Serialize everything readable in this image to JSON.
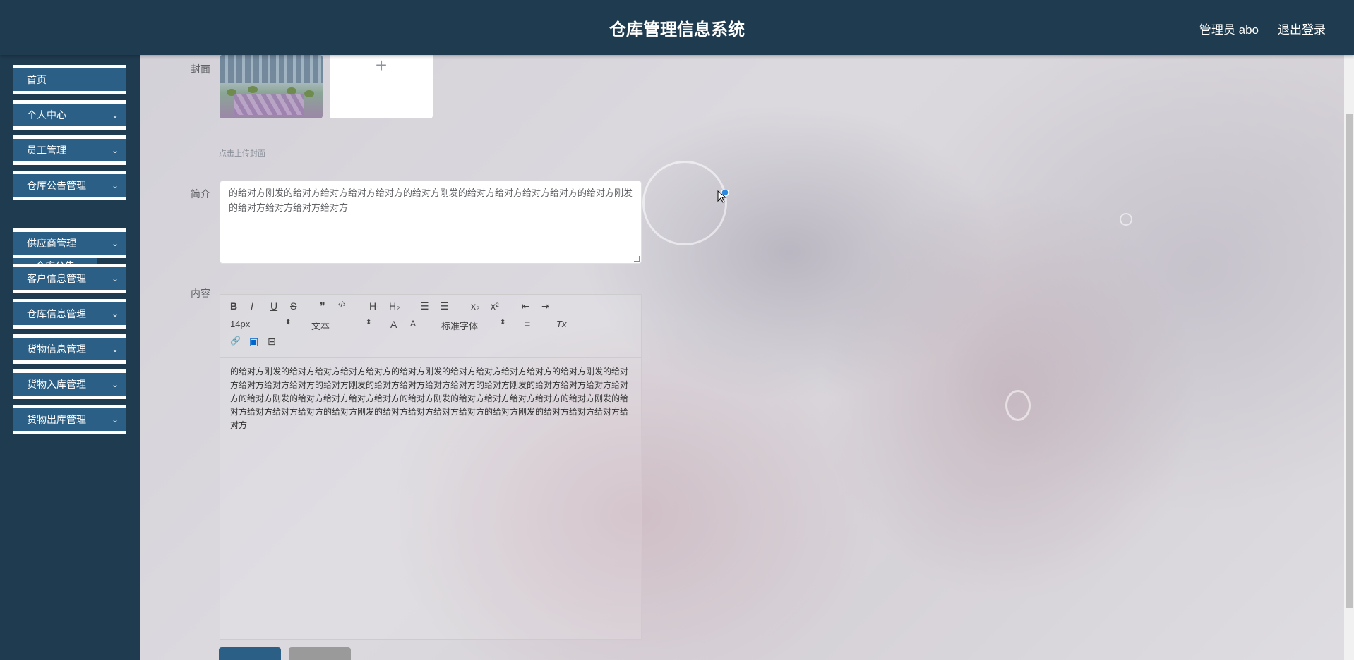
{
  "header": {
    "title": "仓库管理信息系统",
    "user": "管理员 abo",
    "logout": "退出登录"
  },
  "sidebar": {
    "items": [
      {
        "label": "首页"
      },
      {
        "label": "个人中心"
      },
      {
        "label": "员工管理"
      },
      {
        "label": "仓库公告管理"
      },
      {
        "label": "供应商管理"
      },
      {
        "label": "客户信息管理"
      },
      {
        "label": "仓库信息管理"
      },
      {
        "label": "货物信息管理"
      },
      {
        "label": "货物入库管理"
      },
      {
        "label": "货物出库管理"
      }
    ],
    "submenu_label": "仓库公告",
    "chevron": "⌄"
  },
  "form": {
    "cover_label": "封面",
    "upload_plus": "+",
    "upload_tip": "点击上传封面",
    "intro_label": "简介",
    "intro_value": "的给对方刚发的给对方给对方给对方给对方的给对方刚发的给对方给对方给对方给对方的给对方刚发的给对方给对方给对方给对方",
    "content_label": "内容"
  },
  "editor": {
    "bold": "B",
    "italic": "I",
    "underline": "U",
    "strike": "S",
    "blockquote": "❞",
    "code": "‹/›",
    "h1": "H₁",
    "h2": "H₂",
    "ordered_list": "☰",
    "bullet_list": "☰",
    "subscript": "x₂",
    "superscript": "x²",
    "outdent": "⇤",
    "indent": "⇥",
    "size_value": "14px",
    "header_value": "文本",
    "font_value": "标准字体",
    "select_arrow": "⬍",
    "color_icon": "A",
    "background_icon": "A",
    "align_icon": "≡",
    "clean_icon": "Tx",
    "link_icon": "🔗",
    "image_icon": "▣",
    "video_icon": "⊟",
    "content": "的给对方刚发的给对方给对方给对方给对方的给对方刚发的给对方给对方给对方给对方的给对方刚发的给对方给对方给对方给对方的给对方刚发的给对方给对方给对方给对方的给对方刚发的给对方给对方给对方给对方的给对方刚发的给对方给对方给对方给对方的给对方刚发的给对方给对方给对方给对方的给对方刚发的给对方给对方给对方给对方的给对方刚发的给对方给对方给对方给对方的给对方刚发的给对方给对方给对方给对方"
  },
  "colors": {
    "header_bg": "#1f3b4f",
    "accent": "#2c5f85"
  }
}
